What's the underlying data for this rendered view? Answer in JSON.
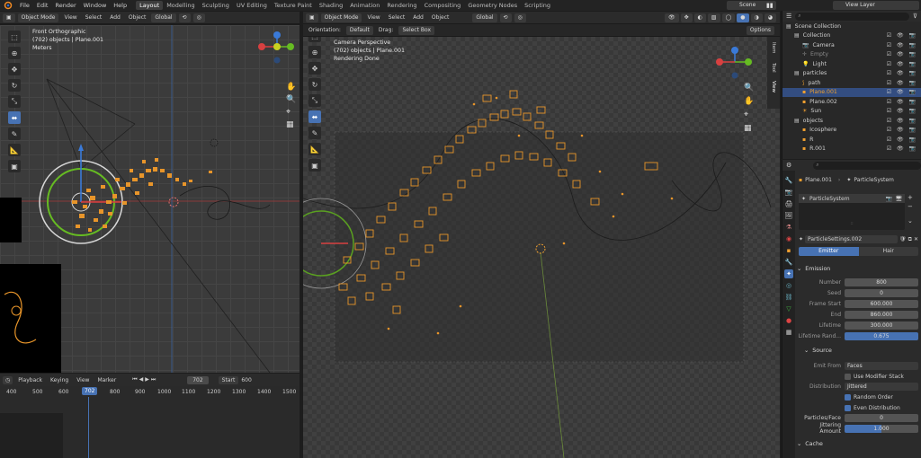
{
  "topbar": {
    "menu": [
      "File",
      "Edit",
      "Render",
      "Window",
      "Help"
    ],
    "workspaces": [
      "Layout",
      "Modelling",
      "Sculpting",
      "UV Editing",
      "Texture Paint",
      "Shading",
      "Animation",
      "Rendering",
      "Compositing",
      "Geometry Nodes",
      "Scripting"
    ],
    "active_workspace": "Layout",
    "scene": "Scene",
    "view_layer": "View Layer"
  },
  "left_viewport": {
    "mode": "Object Mode",
    "menus": [
      "View",
      "Select",
      "Add",
      "Object"
    ],
    "orientation": "Global",
    "overlay_title": "Front Orthographic",
    "overlay_objects": "(702) objects | Plane.001",
    "overlay_units": "Meters"
  },
  "right_viewport": {
    "mode": "Object Mode",
    "menus": [
      "View",
      "Select",
      "Add",
      "Object"
    ],
    "orientation": "Global",
    "sub_orientation_label": "Orientation:",
    "sub_orientation_value": "Default",
    "drag_label": "Drag:",
    "drag_value": "Select Box",
    "options": "Options",
    "overlay_title": "Camera Perspective",
    "overlay_objects": "(702) objects | Plane.001",
    "overlay_status": "Rendering Done",
    "side_tabs": [
      "Item",
      "Tool",
      "View"
    ]
  },
  "outliner": {
    "search_placeholder": "",
    "rows": [
      {
        "label": "Scene Collection",
        "indent": 0,
        "selected": false,
        "color": "#cfcfcf"
      },
      {
        "label": "Collection",
        "indent": 1,
        "selected": false,
        "color": "#cfcfcf"
      },
      {
        "label": "Camera",
        "indent": 2,
        "selected": false,
        "color": "#cfcfcf"
      },
      {
        "label": "Empty",
        "indent": 2,
        "selected": false,
        "color": "#8a8a8a"
      },
      {
        "label": "Light",
        "indent": 2,
        "selected": false,
        "color": "#cfcfcf"
      },
      {
        "label": "particles",
        "indent": 1,
        "selected": false,
        "color": "#cfcfcf"
      },
      {
        "label": "path",
        "indent": 2,
        "selected": false,
        "color": "#cfcfcf"
      },
      {
        "label": "Plane.001",
        "indent": 2,
        "selected": true,
        "color": "#f0a030"
      },
      {
        "label": "Plane.002",
        "indent": 2,
        "selected": false,
        "color": "#cfcfcf"
      },
      {
        "label": "Sun",
        "indent": 2,
        "selected": false,
        "color": "#cfcfcf"
      },
      {
        "label": "objects",
        "indent": 1,
        "selected": false,
        "color": "#cfcfcf"
      },
      {
        "label": "Icosphere",
        "indent": 2,
        "selected": false,
        "color": "#cfcfcf"
      },
      {
        "label": "R",
        "indent": 2,
        "selected": false,
        "color": "#cfcfcf"
      },
      {
        "label": "R.001",
        "indent": 2,
        "selected": false,
        "color": "#cfcfcf"
      }
    ]
  },
  "properties": {
    "breadcrumb_object": "Plane.001",
    "breadcrumb_system": "ParticleSystem",
    "list_item": "ParticleSystem",
    "settings_name": "ParticleSettings.002",
    "type_tabs": [
      "Emitter",
      "Hair"
    ],
    "emission_title": "Emission",
    "emission": [
      {
        "key": "Number",
        "value": "800",
        "highlight": false
      },
      {
        "key": "Seed",
        "value": "0",
        "highlight": false
      },
      {
        "key": "Frame Start",
        "value": "600.000",
        "highlight": false
      },
      {
        "key": "End",
        "value": "860.000",
        "highlight": false
      },
      {
        "key": "Lifetime",
        "value": "300.000",
        "highlight": false
      },
      {
        "key": "Lifetime Rand...",
        "value": "0.675",
        "highlight": true
      }
    ],
    "source_title": "Source",
    "emit_from_label": "Emit From",
    "emit_from_value": "Faces",
    "use_modifier_stack": "Use Modifier Stack",
    "distribution_label": "Distribution",
    "distribution_value": "Jittered",
    "random_order": "Random Order",
    "even_distribution": "Even Distribution",
    "particles_face_label": "Particles/Face",
    "particles_face_value": "0",
    "jittering_label": "Jittering Amount",
    "jittering_value": "1.000",
    "cache_title": "Cache"
  },
  "timeline": {
    "menus": [
      "Playback",
      "Keying",
      "View",
      "Marker"
    ],
    "current_frame": "702",
    "start_label": "Start",
    "start_value": "600",
    "ruler": [
      "400",
      "500",
      "600",
      "702",
      "800",
      "900",
      "1000",
      "1100",
      "1200",
      "1300",
      "1400",
      "1500"
    ]
  },
  "colors": {
    "accent": "#4772b3",
    "selected_orange": "#f0a030",
    "particle": "#e8952a"
  }
}
